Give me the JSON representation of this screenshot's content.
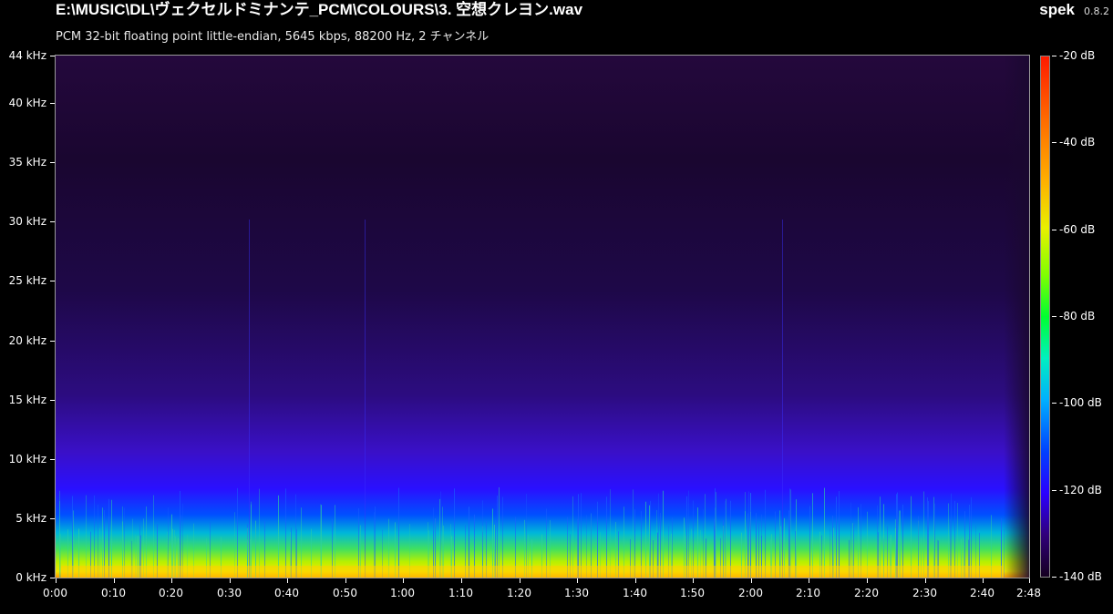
{
  "header": {
    "file_path": "E:\\MUSIC\\DL\\ヴェクセルドミナンテ_PCM\\COLOURS\\3. 空想クレヨン.wav",
    "file_info": "PCM 32-bit floating point little-endian, 5645 kbps, 88200 Hz, 2 チャンネル",
    "app_name": "spek",
    "app_version": "0.8.2"
  },
  "colors": {
    "background": "#000000",
    "text": "#ffffff",
    "spectrogram_floor": "#1a0830"
  },
  "chart_data": {
    "type": "heatmap",
    "title": "",
    "xlabel": "",
    "ylabel": "",
    "x_range": [
      "0:00",
      "2:48"
    ],
    "y_range_khz": [
      0,
      44
    ],
    "color_range_db": [
      -140,
      -20
    ],
    "y_ticks": [
      "0 kHz",
      "5 kHz",
      "10 kHz",
      "15 kHz",
      "20 kHz",
      "25 kHz",
      "30 kHz",
      "35 kHz",
      "40 kHz",
      "44 kHz"
    ],
    "y_tick_values_khz": [
      0,
      5,
      10,
      15,
      20,
      25,
      30,
      35,
      40,
      44
    ],
    "x_ticks": [
      "0:00",
      "0:10",
      "0:20",
      "0:30",
      "0:40",
      "0:50",
      "1:00",
      "1:10",
      "1:20",
      "1:30",
      "1:40",
      "1:50",
      "2:00",
      "2:10",
      "2:20",
      "2:30",
      "2:40",
      "2:48"
    ],
    "x_tick_values_s": [
      0,
      10,
      20,
      30,
      40,
      50,
      60,
      70,
      80,
      90,
      100,
      110,
      120,
      130,
      140,
      150,
      160,
      168
    ],
    "legend_ticks": [
      "-20 dB",
      "-40 dB",
      "-60 dB",
      "-80 dB",
      "-100 dB",
      "-120 dB",
      "-140 dB"
    ],
    "legend_values_db": [
      -20,
      -40,
      -60,
      -80,
      -100,
      -120,
      -140
    ],
    "duration_s": 168
  }
}
